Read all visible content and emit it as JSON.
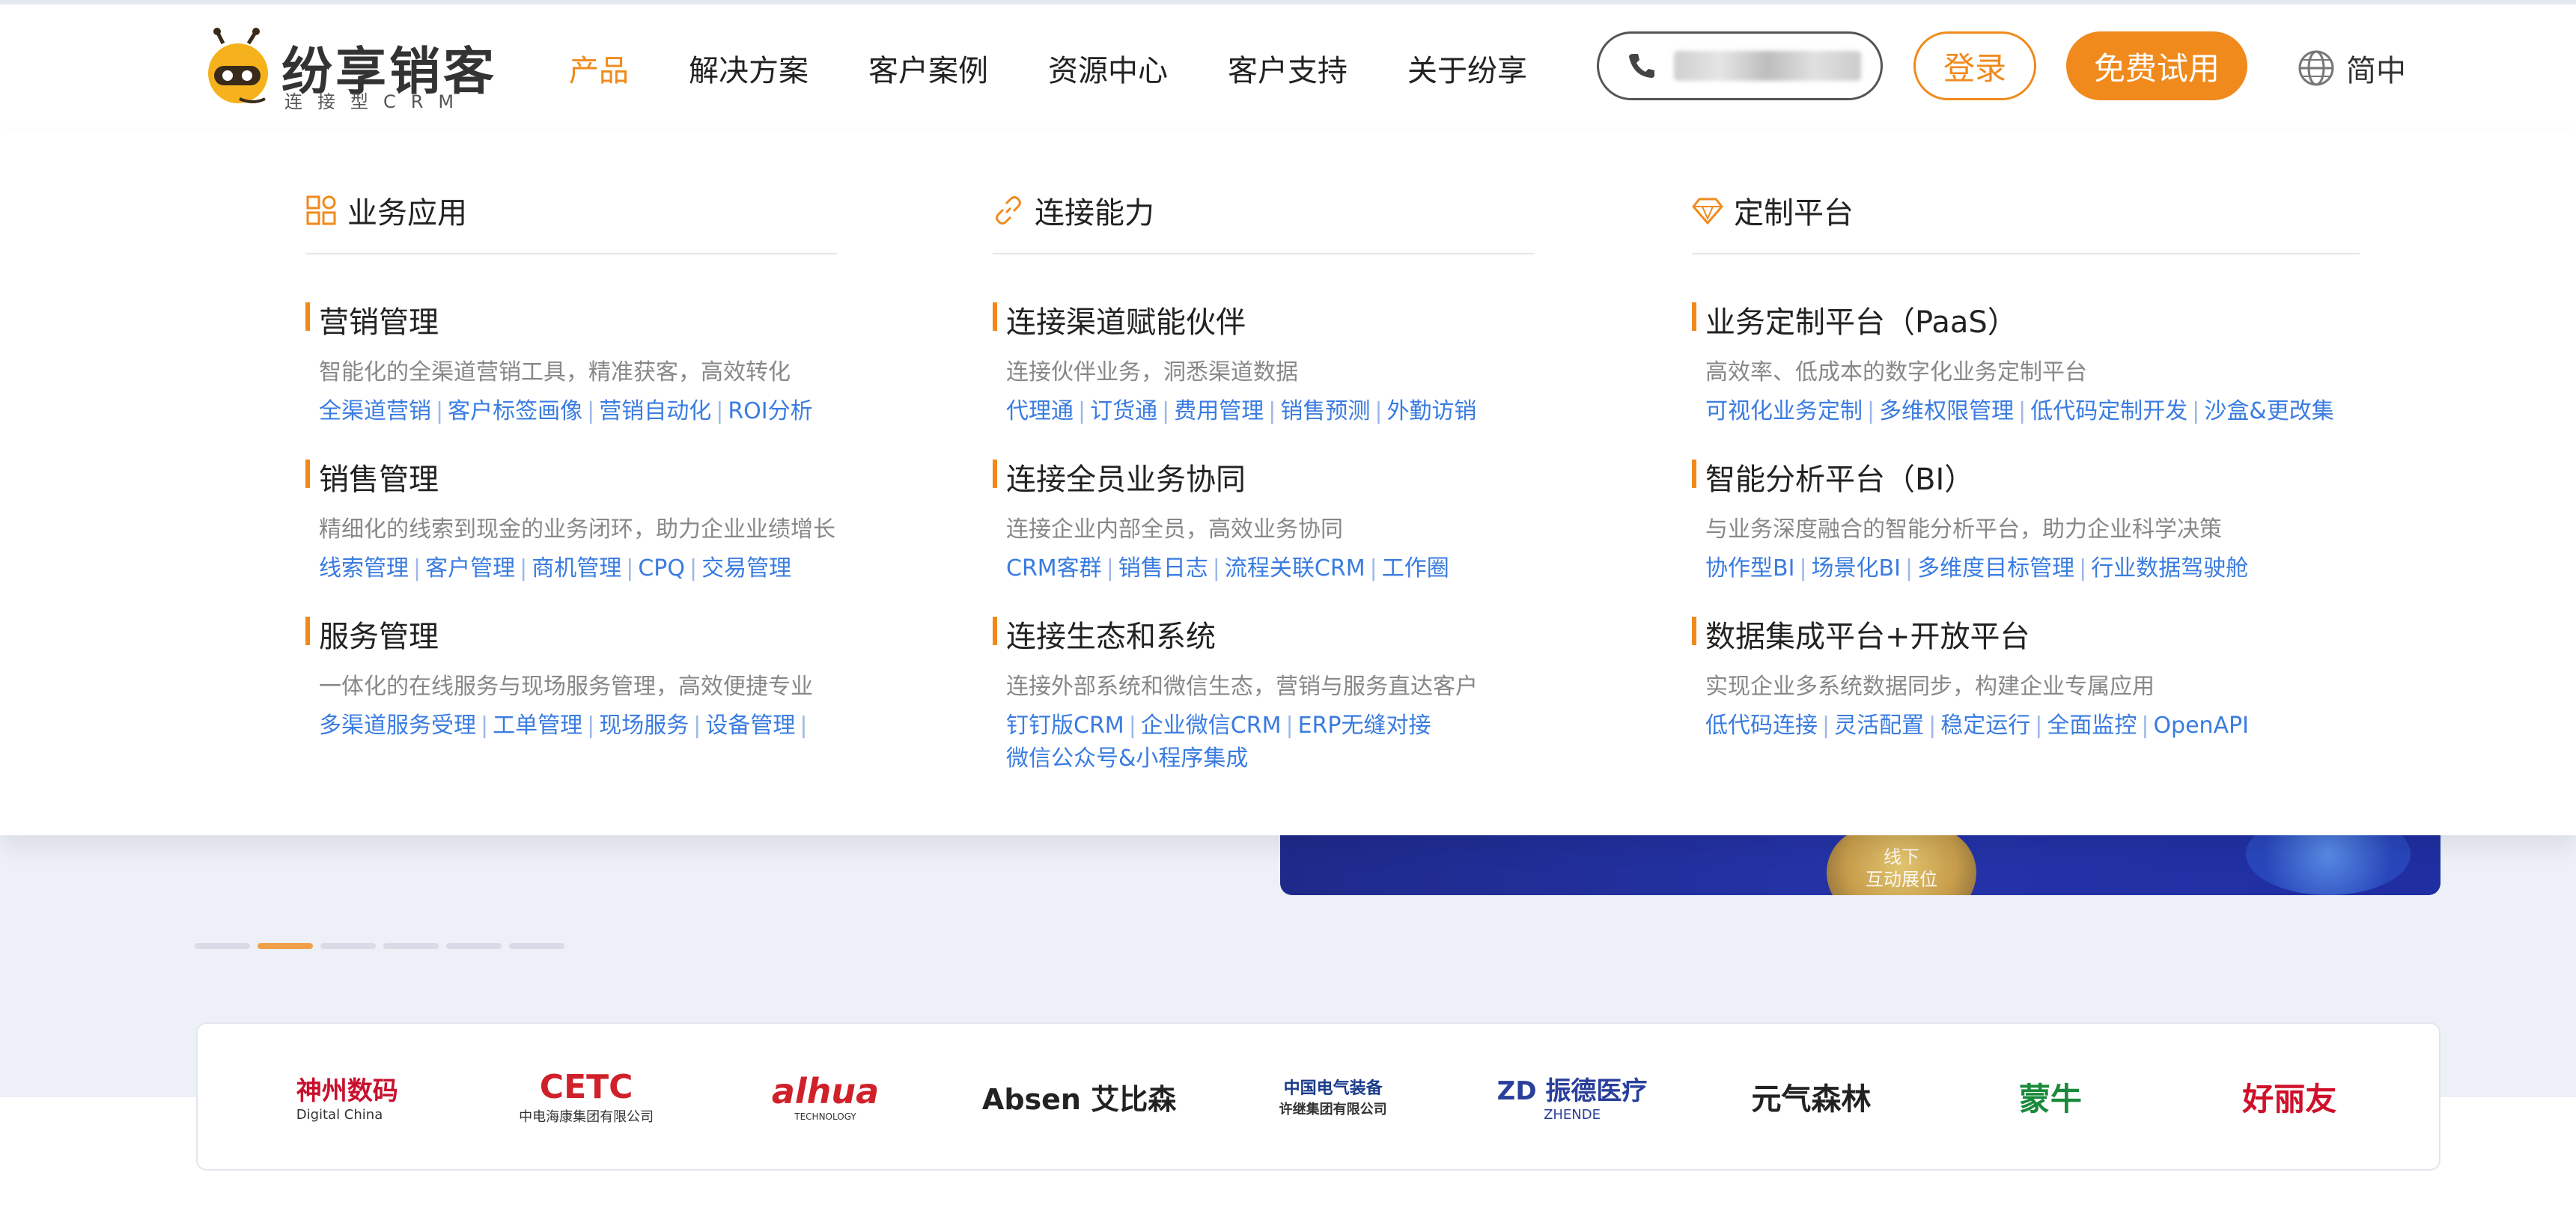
{
  "header": {
    "logo_name": "纷享销客",
    "logo_tag": "连接型CRM",
    "nav": [
      "产品",
      "解决方案",
      "客户案例",
      "资源中心",
      "客户支持",
      "关于纷享"
    ],
    "active_nav": 0,
    "login_label": "登录",
    "trial_label": "免费试用",
    "lang_label": "简中"
  },
  "menu": {
    "columns": [
      {
        "title": "业务应用",
        "icon": "apps-grid-icon",
        "sections": [
          {
            "title": "营销管理",
            "desc": "智能化的全渠道营销工具，精准获客，高效转化",
            "links": [
              "全渠道营销",
              "客户标签画像",
              "营销自动化",
              "ROI分析"
            ]
          },
          {
            "title": "销售管理",
            "desc": "精细化的线索到现金的业务闭环，助力企业业绩增长",
            "links": [
              "线索管理",
              "客户管理",
              "商机管理",
              "CPQ",
              "交易管理"
            ]
          },
          {
            "title": "服务管理",
            "desc": "一体化的在线服务与现场服务管理，高效便捷专业",
            "links": [
              "多渠道服务受理",
              "工单管理",
              "现场服务",
              "设备管理"
            ]
          }
        ]
      },
      {
        "title": "连接能力",
        "icon": "link-icon",
        "sections": [
          {
            "title": "连接渠道赋能伙伴",
            "desc": "连接伙伴业务，洞悉渠道数据",
            "links": [
              "代理通",
              "订货通",
              "费用管理",
              "销售预测",
              "外勤访销"
            ]
          },
          {
            "title": "连接全员业务协同",
            "desc": "连接企业内部全员，高效业务协同",
            "links": [
              "CRM客群",
              "销售日志",
              "流程关联CRM",
              "工作圈"
            ]
          },
          {
            "title": "连接生态和系统",
            "desc": "连接外部系统和微信生态，营销与服务直达客户",
            "links": [
              "钉钉版CRM",
              "企业微信CRM",
              "ERP无缝对接",
              "微信公众号&小程序集成"
            ]
          }
        ]
      },
      {
        "title": "定制平台",
        "icon": "diamond-icon",
        "sections": [
          {
            "title": "业务定制平台（PaaS）",
            "desc": "高效率、低成本的数字化业务定制平台",
            "links": [
              "可视化业务定制",
              "多维权限管理",
              "低代码定制开发",
              "沙盒&更改集"
            ]
          },
          {
            "title": "智能分析平台（BI）",
            "desc": "与业务深度融合的智能分析平台，助力企业科学决策",
            "links": [
              "协作型BI",
              "场景化BI",
              "多维度目标管理",
              "行业数据驾驶舱"
            ]
          },
          {
            "title": "数据集成平台+开放平台",
            "desc": "实现企业多系统数据同步，构建企业专属应用",
            "links": [
              "低代码连接",
              "灵活配置",
              "稳定运行",
              "全面监控",
              "OpenAPI"
            ]
          }
        ]
      }
    ]
  },
  "banner": {
    "orb_text": "线下\n互动展位"
  },
  "carousel": {
    "count": 6,
    "active": 1
  },
  "clients": [
    {
      "name": "神州数码",
      "sub": "Digital China",
      "color": "#c8102e"
    },
    {
      "name": "CETC",
      "sub": "中电海康集团有限公司",
      "color": "#d0202a"
    },
    {
      "name": "alhua",
      "sub": "TECHNOLOGY",
      "color": "#d0202a"
    },
    {
      "name": "Absen 艾比森",
      "sub": "",
      "color": "#111111"
    },
    {
      "name": "中国电气装备",
      "sub": "许继集团有限公司",
      "color": "#1a3a8a"
    },
    {
      "name": "ZD 振德医疗",
      "sub": "ZHENDE",
      "color": "#2a3f9a"
    },
    {
      "name": "元气森林",
      "sub": "",
      "color": "#222222"
    },
    {
      "name": "蒙牛",
      "sub": "",
      "color": "#1a8a3a"
    },
    {
      "name": "好丽友",
      "sub": "",
      "color": "#d0102a"
    }
  ]
}
